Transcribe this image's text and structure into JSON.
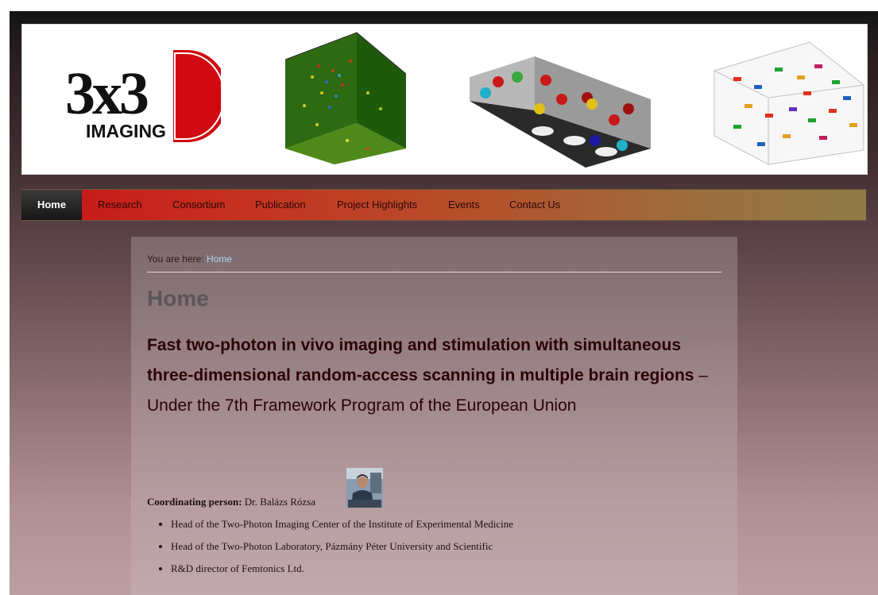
{
  "header": {
    "logo": {
      "big_text": "3x3",
      "sub_text": "IMAGING",
      "accent_color": "#d00a10"
    },
    "banner_images": [
      "brain-volume-image",
      "scanning-spheres-image",
      "neuron-tracks-image"
    ]
  },
  "nav": {
    "items": [
      {
        "label": "Home",
        "active": true
      },
      {
        "label": "Research"
      },
      {
        "label": "Consortium"
      },
      {
        "label": "Publication"
      },
      {
        "label": "Project Highlights"
      },
      {
        "label": "Events"
      },
      {
        "label": "Contact Us"
      }
    ]
  },
  "breadcrumb": {
    "prefix": "You are here:",
    "current": "Home"
  },
  "main": {
    "title": "Home",
    "lead_bold": "Fast two-photon in vivo imaging and stimulation with simultaneous three-dimensional random-access scanning in multiple brain regions",
    "lead_rest": " – Under the 7th Framework Program of the European Union",
    "coordinator": {
      "label": "Coordinating person:",
      "name": "Dr. Balázs Rózsa"
    },
    "roles": [
      "Head of the Two-Photon Imaging Center of the Institute of Experimental Medicine",
      "Head of the Two-Photon Laboratory, Pázmány Péter University and Scientific",
      "R&D director of Femtonics Ltd."
    ]
  },
  "colors": {
    "nav_start": "#c8141a",
    "nav_end": "#8e7a46",
    "link": "#a9d4f5",
    "lead_text": "#2c0204"
  }
}
